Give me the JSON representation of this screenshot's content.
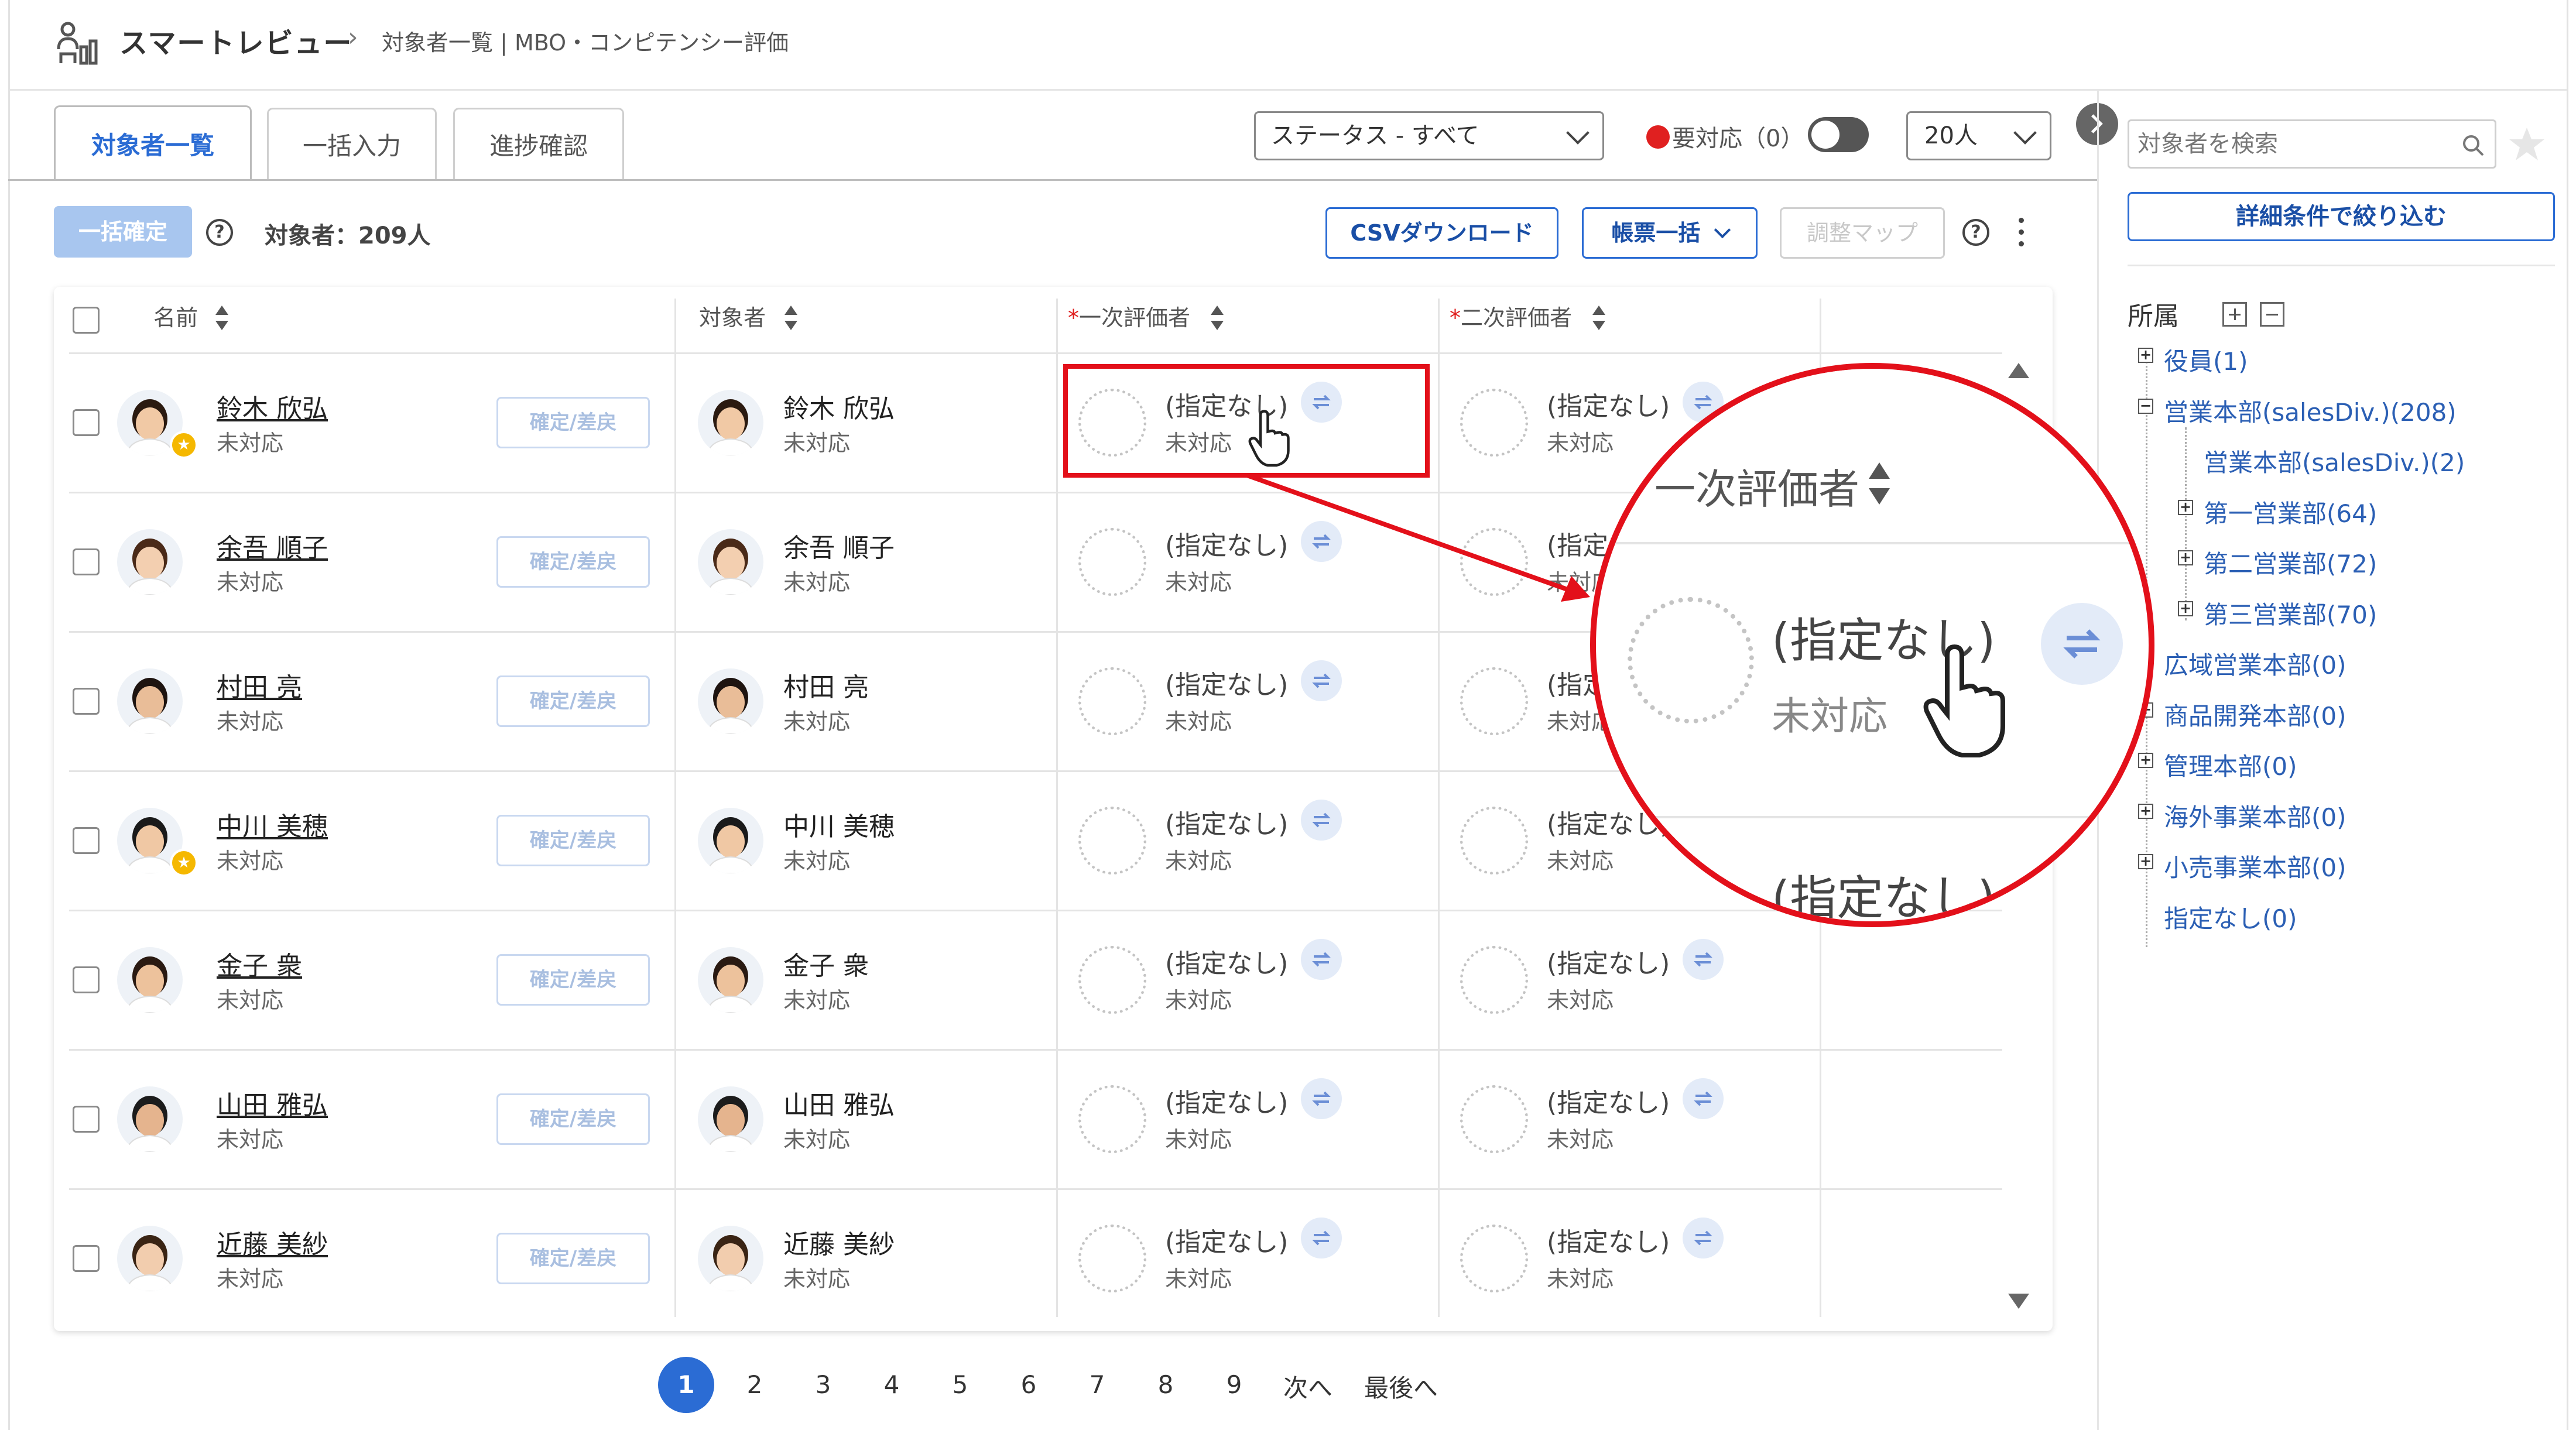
{
  "app": {
    "title": "スマートレビュー",
    "breadcrumb_separator": "›",
    "page": "対象者一覧 | MBO・コンピテンシー評価"
  },
  "tabs": [
    {
      "label": "対象者一覧",
      "active": true
    },
    {
      "label": "一括入力",
      "active": false
    },
    {
      "label": "進捗確認",
      "active": false
    }
  ],
  "filters": {
    "status": "ステータス - すべて",
    "need_action_label": "要対応（0）",
    "need_action_toggle": "off",
    "per_page": "20人"
  },
  "toolbar": {
    "bulk_confirm": "一括確定",
    "help": "?",
    "target_count": "対象者：209人",
    "csv_download": "CSVダウンロード",
    "forms_bulk": "帳票一括",
    "adjust_map": "調整マップ"
  },
  "table": {
    "columns": {
      "name": "名前",
      "target": "対象者",
      "required_mark": "*",
      "first_eval": "一次評価者",
      "second_eval": "二次評価者"
    },
    "confirm_button": "確定/差戻",
    "eval_value": "(指定なし)",
    "status": "未対応",
    "rows": [
      {
        "name": "鈴木 欣弘",
        "status": "未対応",
        "starred": true,
        "second_eval_visible": true
      },
      {
        "name": "余吾 順子",
        "status": "未対応",
        "starred": false,
        "second_eval_visible": true
      },
      {
        "name": "村田 亮",
        "status": "未対応",
        "starred": false,
        "second_eval_visible": true
      },
      {
        "name": "中川 美穂",
        "status": "未対応",
        "starred": true,
        "second_eval_visible": true
      },
      {
        "name": "金子 衆",
        "status": "未対応",
        "starred": false,
        "second_eval_visible": true
      },
      {
        "name": "山田 雅弘",
        "status": "未対応",
        "starred": false,
        "second_eval_visible": true
      },
      {
        "name": "近藤 美紗",
        "status": "未対応",
        "starred": false,
        "second_eval_visible": true
      }
    ]
  },
  "pagination": {
    "pages": [
      "1",
      "2",
      "3",
      "4",
      "5",
      "6",
      "7",
      "8",
      "9"
    ],
    "current": "1",
    "next": "次へ",
    "last": "最後へ"
  },
  "sidebar": {
    "search_placeholder": "対象者を検索",
    "filter_button": "詳細条件で絞り込む",
    "org_title": "所属",
    "tree": [
      {
        "label": "役員(1)",
        "expandable": true,
        "level": 0
      },
      {
        "label": "営業本部(salesDiv.)(208)",
        "expandable": true,
        "expanded": true,
        "level": 0
      },
      {
        "label": "営業本部(salesDiv.)(2)",
        "expandable": false,
        "level": 1
      },
      {
        "label": "第一営業部(64)",
        "expandable": true,
        "level": 1
      },
      {
        "label": "第二営業部(72)",
        "expandable": true,
        "level": 1
      },
      {
        "label": "第三営業部(70)",
        "expandable": true,
        "level": 1
      },
      {
        "label": "広域営業本部(0)",
        "expandable": true,
        "level": 0
      },
      {
        "label": "商品開発本部(0)",
        "expandable": true,
        "level": 0
      },
      {
        "label": "管理本部(0)",
        "expandable": true,
        "level": 0
      },
      {
        "label": "海外事業本部(0)",
        "expandable": true,
        "level": 0
      },
      {
        "label": "小売事業本部(0)",
        "expandable": true,
        "level": 0
      },
      {
        "label": "指定なし(0)",
        "expandable": false,
        "level": 0
      }
    ]
  },
  "zoom_callout": {
    "header": "一次評価者",
    "value": "(指定なし)",
    "status": "未対応",
    "next_value": "(指定なし)"
  },
  "colors": {
    "accent": "#2b6cd4",
    "callout": "#e3101a",
    "badge": "#f5b800",
    "need_action_dot": "#e02020"
  }
}
